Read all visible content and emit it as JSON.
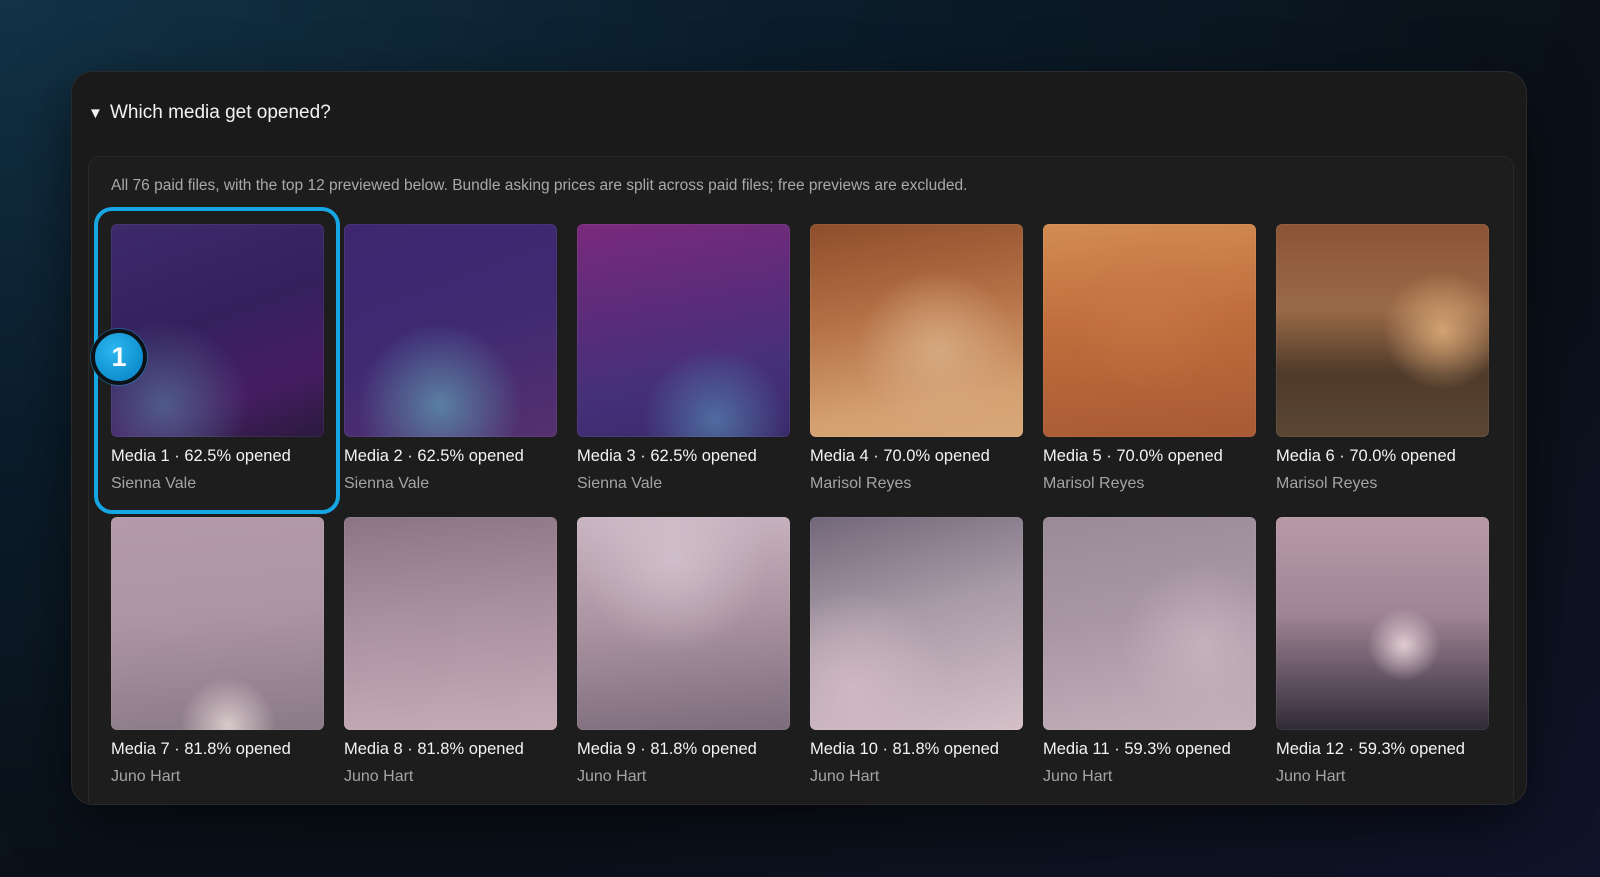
{
  "section": {
    "disclosure_icon": "triangle-down-icon",
    "title": "Which media get opened?",
    "caption": "All 76 paid files, with the top 12 previewed below. Bundle asking prices are split across paid files; free previews are excluded."
  },
  "media": [
    {
      "title": "Media 1 · 62.5% opened",
      "creator": "Sienna Vale"
    },
    {
      "title": "Media 2 · 62.5% opened",
      "creator": "Sienna Vale"
    },
    {
      "title": "Media 3 · 62.5% opened",
      "creator": "Sienna Vale"
    },
    {
      "title": "Media 4 · 70.0% opened",
      "creator": "Marisol Reyes"
    },
    {
      "title": "Media 5 · 70.0% opened",
      "creator": "Marisol Reyes"
    },
    {
      "title": "Media 6 · 70.0% opened",
      "creator": "Marisol Reyes"
    },
    {
      "title": "Media 7 · 81.8% opened",
      "creator": "Juno Hart"
    },
    {
      "title": "Media 8 · 81.8% opened",
      "creator": "Juno Hart"
    },
    {
      "title": "Media 9 · 81.8% opened",
      "creator": "Juno Hart"
    },
    {
      "title": "Media 10 · 81.8% opened",
      "creator": "Juno Hart"
    },
    {
      "title": "Media 11 · 59.3% opened",
      "creator": "Juno Hart"
    },
    {
      "title": "Media 12 · 59.3% opened",
      "creator": "Juno Hart"
    }
  ],
  "callout": {
    "number": "1",
    "accent_color": "#16a6e3"
  }
}
